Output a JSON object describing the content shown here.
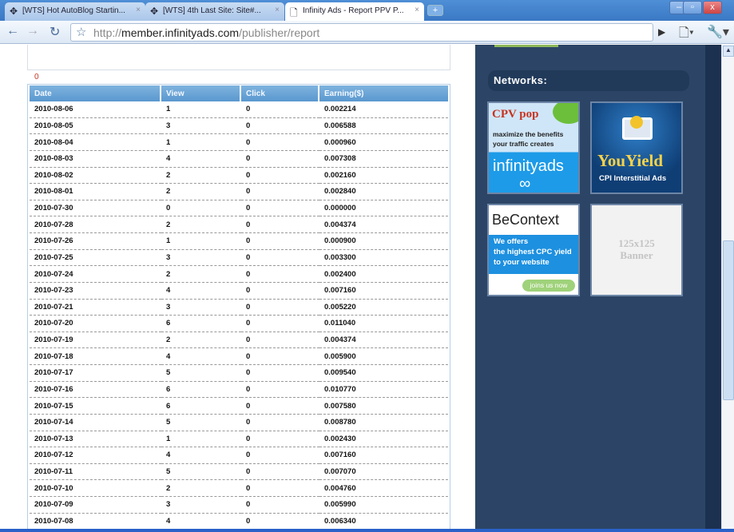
{
  "browser": {
    "tabs": [
      {
        "title": "[WTS] Hot AutoBlog Startin...",
        "active": false
      },
      {
        "title": "[WTS] 4th Last Site: Site#...",
        "active": false
      },
      {
        "title": "Infinity Ads - Report PPV P...",
        "active": true
      }
    ],
    "new_tab": "+",
    "url_prefix": "http://",
    "url_host": "member.infinityads.com",
    "url_path": "/publisher/report",
    "window_buttons": [
      "–",
      "▫",
      "x"
    ]
  },
  "report": {
    "count_label": "0",
    "columns": [
      "Date",
      "View",
      "Click",
      "Earning($)"
    ],
    "rows": [
      [
        "2010-08-06",
        "1",
        "0",
        "0.002214"
      ],
      [
        "2010-08-05",
        "3",
        "0",
        "0.006588"
      ],
      [
        "2010-08-04",
        "1",
        "0",
        "0.000960"
      ],
      [
        "2010-08-03",
        "4",
        "0",
        "0.007308"
      ],
      [
        "2010-08-02",
        "2",
        "0",
        "0.002160"
      ],
      [
        "2010-08-01",
        "2",
        "0",
        "0.002840"
      ],
      [
        "2010-07-30",
        "0",
        "0",
        "0.000000"
      ],
      [
        "2010-07-28",
        "2",
        "0",
        "0.004374"
      ],
      [
        "2010-07-26",
        "1",
        "0",
        "0.000900"
      ],
      [
        "2010-07-25",
        "3",
        "0",
        "0.003300"
      ],
      [
        "2010-07-24",
        "2",
        "0",
        "0.002400"
      ],
      [
        "2010-07-23",
        "4",
        "0",
        "0.007160"
      ],
      [
        "2010-07-21",
        "3",
        "0",
        "0.005220"
      ],
      [
        "2010-07-20",
        "6",
        "0",
        "0.011040"
      ],
      [
        "2010-07-19",
        "2",
        "0",
        "0.004374"
      ],
      [
        "2010-07-18",
        "4",
        "0",
        "0.005900"
      ],
      [
        "2010-07-17",
        "5",
        "0",
        "0.009540"
      ],
      [
        "2010-07-16",
        "6",
        "0",
        "0.010770"
      ],
      [
        "2010-07-15",
        "6",
        "0",
        "0.007580"
      ],
      [
        "2010-07-14",
        "5",
        "0",
        "0.008780"
      ],
      [
        "2010-07-13",
        "1",
        "0",
        "0.002430"
      ],
      [
        "2010-07-12",
        "4",
        "0",
        "0.007160"
      ],
      [
        "2010-07-11",
        "5",
        "0",
        "0.007070"
      ],
      [
        "2010-07-10",
        "2",
        "0",
        "0.004760"
      ],
      [
        "2010-07-09",
        "3",
        "0",
        "0.005990"
      ],
      [
        "2010-07-08",
        "4",
        "0",
        "0.006340"
      ]
    ]
  },
  "sidebar": {
    "heading": "Networks:",
    "ads": {
      "cpvpop": {
        "title": "CPV pop",
        "line1": "maximize the benefits",
        "line2": "your traffic creates",
        "brand": "infinityads"
      },
      "youyield": {
        "title": "YouYield",
        "sub": "CPI Interstitial Ads"
      },
      "becontext": {
        "title": "BeContext",
        "line1": "We offers",
        "line2": "the highest CPC yield",
        "line3": "to your website",
        "cta": "joins us now"
      },
      "placeholder": {
        "line1": "125x125",
        "line2": "Banner"
      }
    }
  }
}
